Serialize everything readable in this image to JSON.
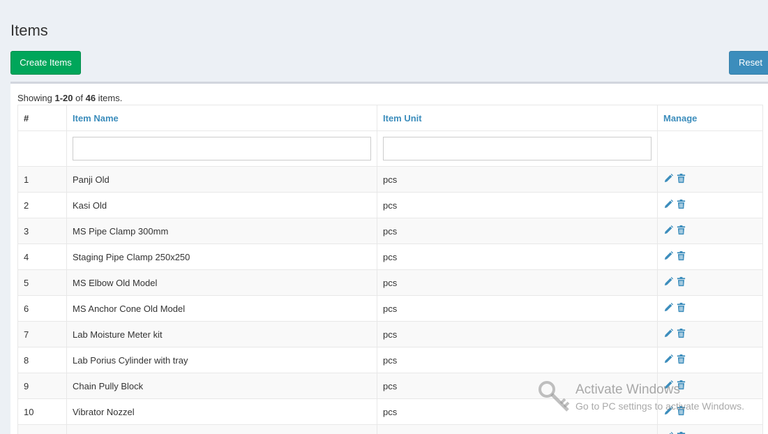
{
  "page": {
    "title": "Items"
  },
  "toolbar": {
    "create_label": "Create Items",
    "reset_label": "Reset"
  },
  "summary": {
    "prefix": "Showing ",
    "range": "1-20",
    "middle": " of ",
    "total": "46",
    "suffix": " items."
  },
  "table": {
    "columns": [
      "#",
      "Item Name",
      "Item Unit",
      "Manage"
    ],
    "filters": {
      "item_name": "",
      "item_unit": ""
    },
    "rows": [
      {
        "num": "1",
        "name": "Panji Old",
        "unit": "pcs"
      },
      {
        "num": "2",
        "name": "Kasi Old",
        "unit": "pcs"
      },
      {
        "num": "3",
        "name": "MS Pipe Clamp 300mm",
        "unit": "pcs"
      },
      {
        "num": "4",
        "name": "Staging Pipe Clamp 250x250",
        "unit": "pcs"
      },
      {
        "num": "5",
        "name": "MS Elbow Old Model",
        "unit": "pcs"
      },
      {
        "num": "6",
        "name": "MS Anchor Cone Old Model",
        "unit": "pcs"
      },
      {
        "num": "7",
        "name": "Lab Moisture Meter kit",
        "unit": "pcs"
      },
      {
        "num": "8",
        "name": "Lab Porius Cylinder with tray",
        "unit": "pcs"
      },
      {
        "num": "9",
        "name": "Chain Pully Block",
        "unit": "pcs"
      },
      {
        "num": "10",
        "name": "Vibrator Nozzel",
        "unit": "pcs"
      },
      {
        "num": "",
        "name": "",
        "unit": ""
      }
    ]
  },
  "icons": {
    "edit": "pencil-icon",
    "delete": "trash-icon"
  },
  "colors": {
    "link": "#3c8dbc",
    "create_button": "#00a65a",
    "reset_button": "#3c8dbc",
    "background": "#ecf0f5"
  },
  "watermark": {
    "title": "Activate Windows",
    "subtitle": "Go to PC settings to activate Windows."
  }
}
